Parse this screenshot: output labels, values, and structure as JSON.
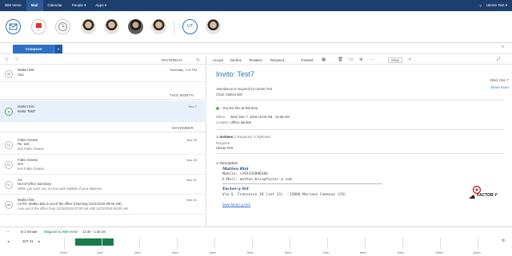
{
  "nav": {
    "items": [
      "IBM Verse",
      "Mail",
      "Calendar",
      "People",
      "Apps"
    ],
    "dropdown_items": [
      "People",
      "Apps"
    ],
    "active": "Mail",
    "user": "Utente Test",
    "bar_color": "#1d3f6e"
  },
  "people_bar": {
    "todo_badge": "7",
    "initials": "UT",
    "icons": [
      "mail-clock-icon",
      "calendar-badge-icon",
      "clock-icon"
    ]
  },
  "compose": {
    "label": "Compose"
  },
  "list": {
    "header": "YESTERDAY",
    "groups": [
      {
        "label": "THIS MONTH"
      },
      {
        "label": "NOVEMBER"
      }
    ],
    "rows": [
      {
        "avatar": "MB",
        "from": "Matteo Bisi",
        "subject": "ciao",
        "snippet": "",
        "date": "Yesterday, 7:02 PM"
      },
      {
        "avatar": "",
        "from": "Matteo Bisi",
        "subject": "Invito: Test7",
        "snippet": "",
        "date": "Dec 7"
      },
      {
        "avatar": "FG",
        "from": "Fabio Grasso",
        "subject": "Re: test",
        "snippet": "test Fabio Grasso",
        "date": "Nov 25"
      },
      {
        "avatar": "FG",
        "from": "Fabio Grasso",
        "subject": "test",
        "snippet": "test Fabio Grasso",
        "date": "Nov 25"
      },
      {
        "avatar": "UT",
        "from": "me",
        "subject": "Out-of-office Summary",
        "snippet": "While you were out, no-one was notified of your absence.",
        "date": "Nov 21"
      },
      {
        "avatar": "MB",
        "from": "Matteo Bisi",
        "subject": "AUTO: Matteo Bisi is out of the office (returning 11/21/2016 09:00 AM)",
        "snippet": "I am out of the office from 11/18/2016 07:00 AM until 11/21/2016 09:00 AM.",
        "date": "Nov 21"
      }
    ]
  },
  "reading": {
    "toolbar": [
      "Accept",
      "Decline",
      "Tentative",
      "Respond...",
      "Forward"
    ],
    "folder": "Inbox",
    "title": "Invito: Test7",
    "date": "Wed, Dec 7",
    "attendance": "Attendance is required for Utente Test",
    "chair": "Chair: Matteo Bisi",
    "show_more": "Show more",
    "free_text": "You are free at this time.",
    "when_label": "When",
    "when_value": "Wed, Dec 7, 2016 10:00 AM - 10:30 AM",
    "location_label": "Location",
    "location_value": "Ufficio daniele",
    "invitees_label": "Invitees",
    "invitees_count": "1 Required, 0 Optional",
    "required_label": "Required",
    "required_value": "Utente Test",
    "description_label": "Description",
    "sig_name": "Matteo Bisi",
    "sig_mobile": "Mobile: +393332096384",
    "sig_email": "E-Mail: matteo.bisi@factor-y.com",
    "sig_company": "Factor-y Srl",
    "sig_address": "Via S. Francesco 19 (int 21) - 22066 Mariano Comense (CO)",
    "sig_web": "www.factor-y.com",
    "logo_text": "FACTOR-Y"
  },
  "timeline": {
    "in_label": "in 1 minute",
    "blog": "Blogpost su IBM Verse",
    "time": "12:30 - 1:30 am",
    "date": "SAT 31",
    "ticks": [
      "12am",
      "1am",
      "2am",
      "3am",
      "4am",
      "5am",
      "6am",
      "7am",
      "8am",
      "9am",
      "10am",
      "11am"
    ],
    "event_color": "#1a7a4c"
  }
}
